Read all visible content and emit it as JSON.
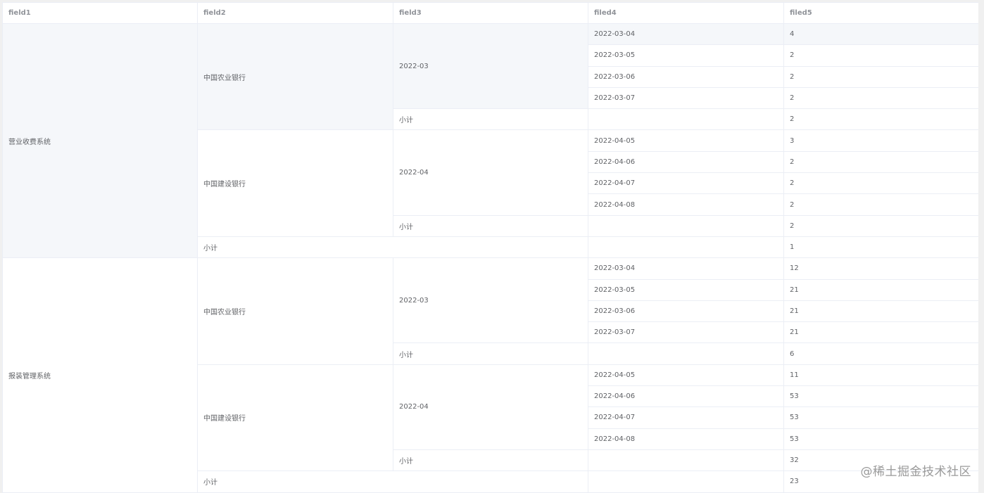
{
  "table": {
    "headers": [
      "field1",
      "field2",
      "field3",
      "filed4",
      "filed5"
    ],
    "subtotal_label": "小计",
    "groups": [
      {
        "system": "营业收费系统",
        "banks": [
          {
            "bank": "中国农业银行",
            "month": "2022-03",
            "days": [
              {
                "date": "2022-03-04",
                "value": "4"
              },
              {
                "date": "2022-03-05",
                "value": "2"
              },
              {
                "date": "2022-03-06",
                "value": "2"
              },
              {
                "date": "2022-03-07",
                "value": "2"
              }
            ],
            "subtotal": "2"
          },
          {
            "bank": "中国建设银行",
            "month": "2022-04",
            "days": [
              {
                "date": "2022-04-05",
                "value": "3"
              },
              {
                "date": "2022-04-06",
                "value": "2"
              },
              {
                "date": "2022-04-07",
                "value": "2"
              },
              {
                "date": "2022-04-08",
                "value": "2"
              }
            ],
            "subtotal": "2"
          }
        ],
        "subtotal": "1"
      },
      {
        "system": "报装管理系统",
        "banks": [
          {
            "bank": "中国农业银行",
            "month": "2022-03",
            "days": [
              {
                "date": "2022-03-04",
                "value": "12"
              },
              {
                "date": "2022-03-05",
                "value": "21"
              },
              {
                "date": "2022-03-06",
                "value": "21"
              },
              {
                "date": "2022-03-07",
                "value": "21"
              }
            ],
            "subtotal": "6"
          },
          {
            "bank": "中国建设银行",
            "month": "2022-04",
            "days": [
              {
                "date": "2022-04-05",
                "value": "11"
              },
              {
                "date": "2022-04-06",
                "value": "53"
              },
              {
                "date": "2022-04-07",
                "value": "53"
              },
              {
                "date": "2022-04-08",
                "value": "53"
              }
            ],
            "subtotal": "32"
          }
        ],
        "subtotal": "23"
      }
    ]
  },
  "watermark": "@稀土掘金技术社区"
}
